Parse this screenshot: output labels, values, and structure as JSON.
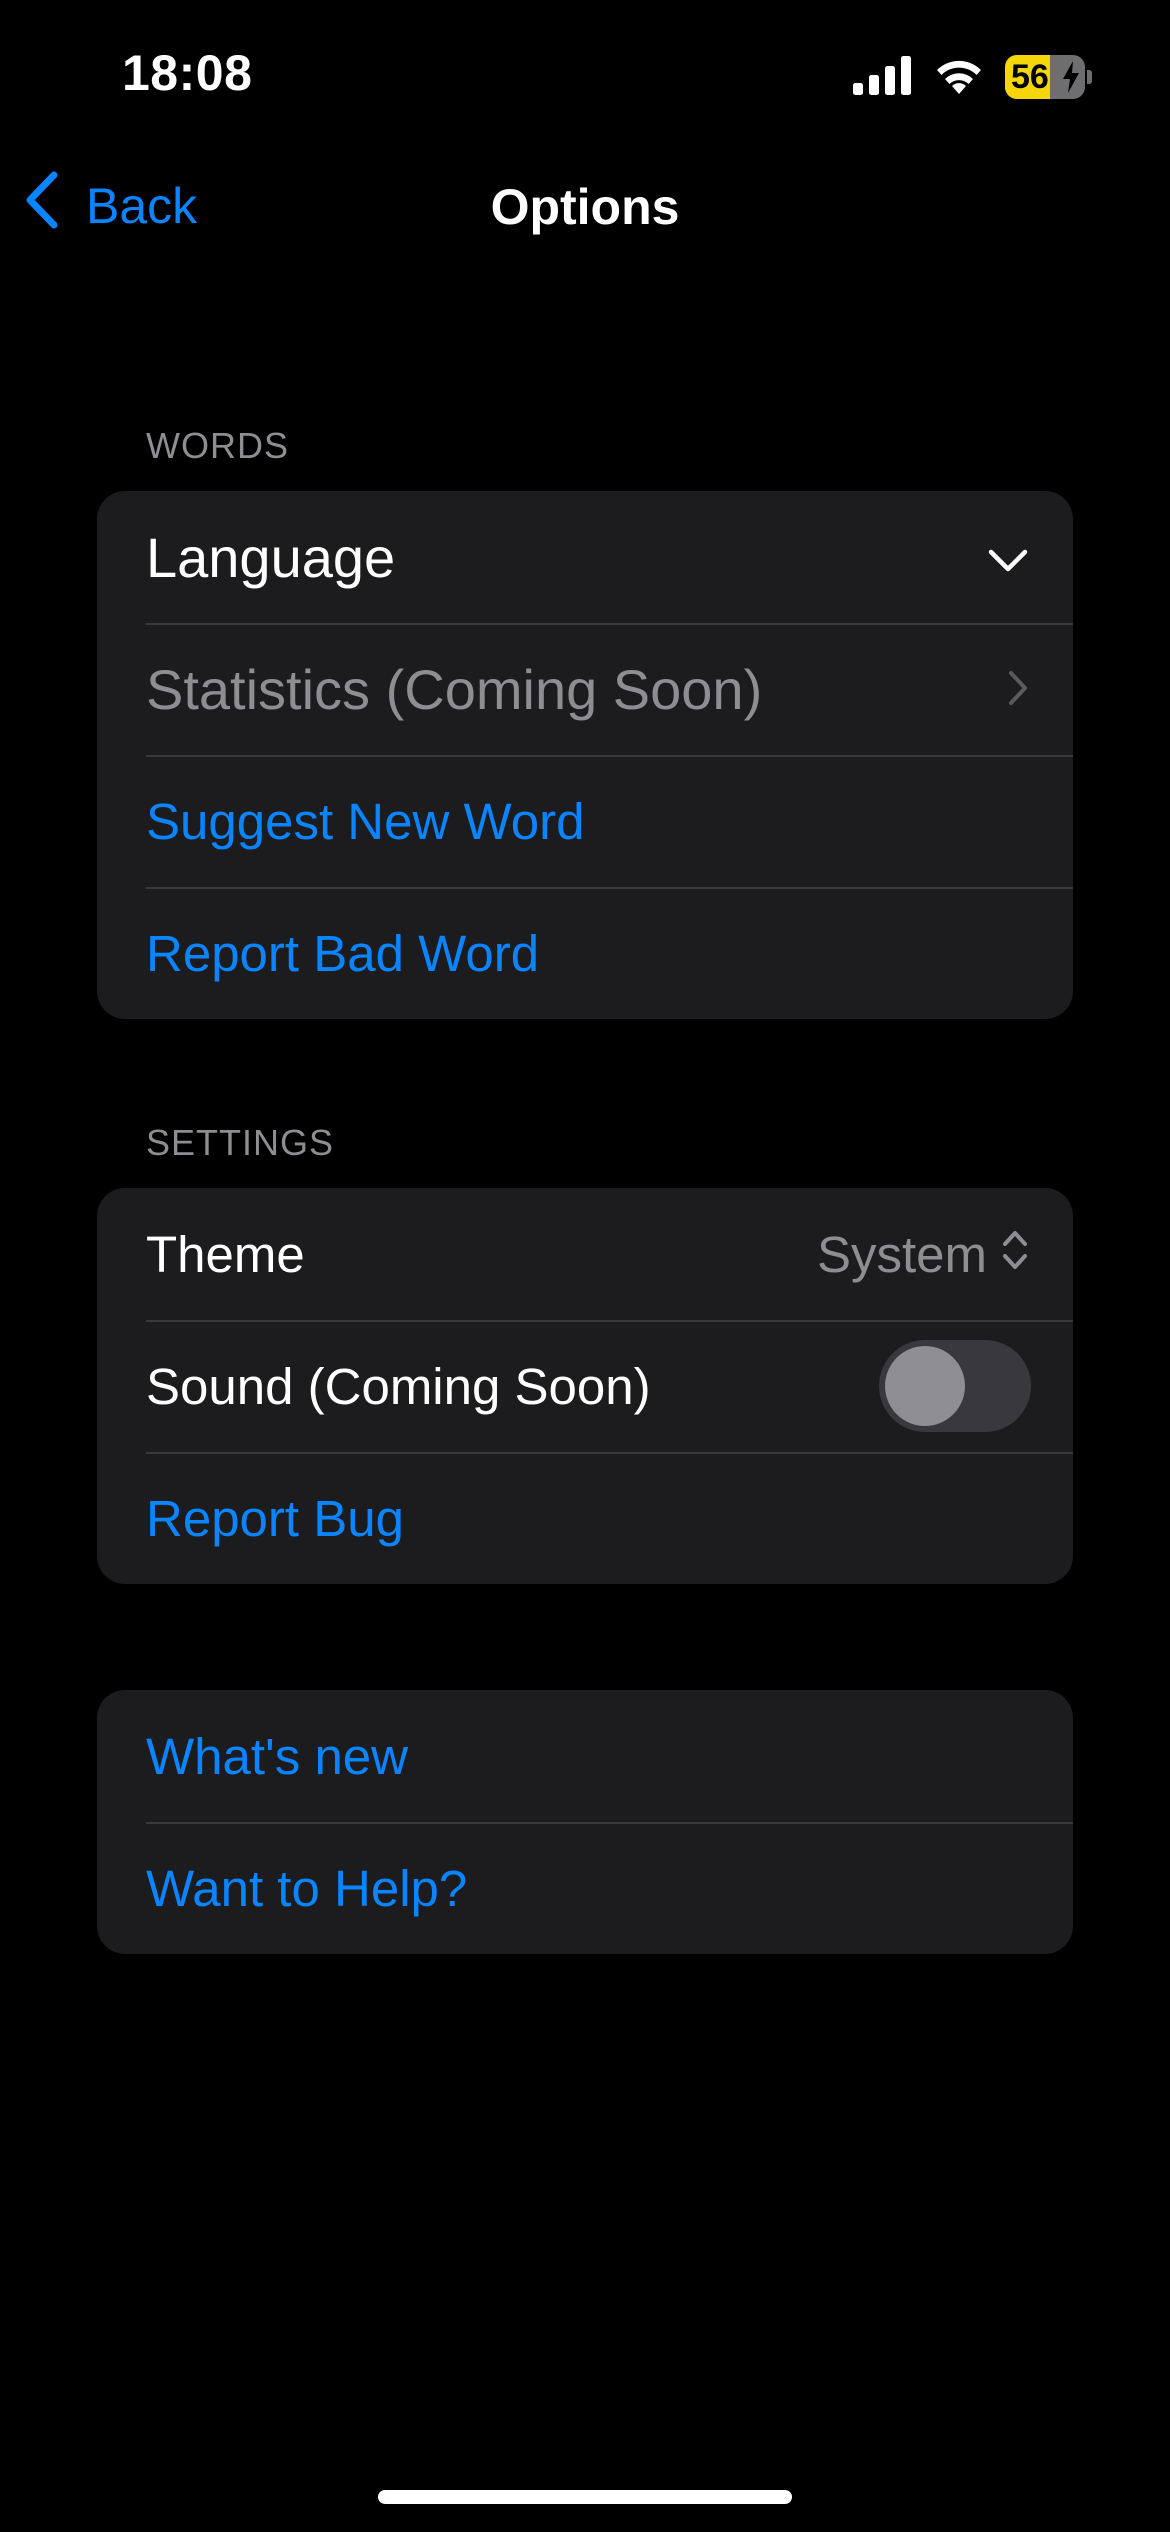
{
  "status_bar": {
    "time": "18:08",
    "battery_level": "56",
    "battery_fraction": 0.56,
    "charging": true,
    "icons": [
      "cellular-signal-icon",
      "wifi-icon",
      "battery-charging-icon"
    ]
  },
  "nav": {
    "back_label": "Back",
    "title": "Options"
  },
  "sections": {
    "words": {
      "header": "WORDS",
      "language_label": "Language",
      "statistics_label": "Statistics (Coming Soon)",
      "suggest_label": "Suggest New Word",
      "report_word_label": "Report Bad Word"
    },
    "settings": {
      "header": "SETTINGS",
      "theme_label": "Theme",
      "theme_value": "System",
      "sound_label": "Sound (Coming Soon)",
      "sound_enabled": false,
      "report_bug_label": "Report Bug"
    },
    "more": {
      "whats_new_label": "What's new",
      "want_help_label": "Want to Help?"
    }
  },
  "colors": {
    "accent": "#0a84ff",
    "background": "#000000",
    "card": "#1c1c1e",
    "secondary_text": "#8d8d92",
    "battery_fill": "#f5d60a"
  }
}
